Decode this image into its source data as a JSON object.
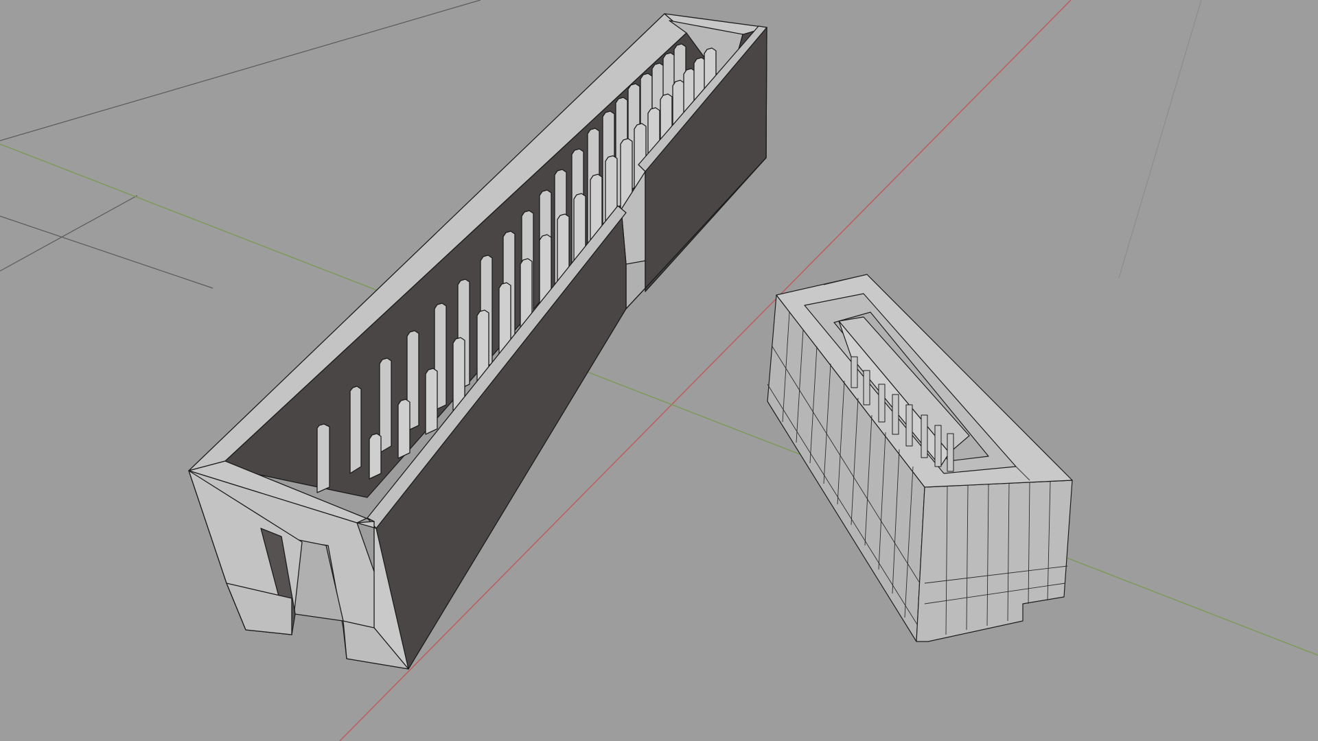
{
  "app": {
    "view": "3d-viewport-perspective",
    "shading": "solid-with-edges"
  },
  "colors": {
    "background": "#9d9d9d",
    "grid_line": "#5c5c5c",
    "x_axis": "#c85a5a",
    "y_axis": "#7e9e5a",
    "light_face": "#c5c5c5",
    "mid_face": "#b3b3b3",
    "dark_face": "#4a4646",
    "edge": "#1e1e1e"
  },
  "objects": [
    {
      "name": "idc-box-header-connector",
      "pin_count": 40
    },
    {
      "name": "fpc-socket-connector",
      "pin_count": 8
    }
  ]
}
